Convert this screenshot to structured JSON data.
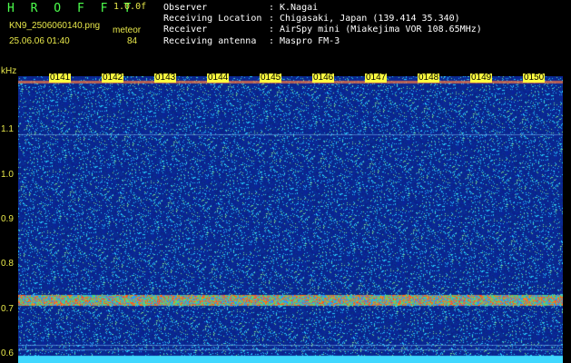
{
  "header": {
    "brand": "H R O F F T",
    "version": "1.0.0f",
    "filename": "KN9_2506060140.png",
    "datetime": "25.06.06 01:40",
    "category_label": "meteor",
    "count": "84",
    "meta": [
      {
        "key": "Observer",
        "value": "K.Nagai"
      },
      {
        "key": "Receiving Location",
        "value": "Chigasaki, Japan (139.414 35.340)"
      },
      {
        "key": "Receiver",
        "value": "AirSpy mini (Miakejima VOR 108.65MHz)"
      },
      {
        "key": "Receiving antenna",
        "value": "Maspro FM-3"
      }
    ]
  },
  "chart_data": {
    "type": "heatmap",
    "ylabel": "kHz",
    "yticks": [
      "1.1",
      "1.0",
      "0.9",
      "0.8",
      "0.7",
      "0.6"
    ],
    "ylim": [
      0.58,
      1.22
    ],
    "xticks": [
      "0141",
      "0142",
      "0143",
      "0144",
      "0145",
      "0146",
      "0147",
      "0148",
      "0149",
      "0150"
    ],
    "carrier_khz": 0.72,
    "colors": {
      "background": "#0a1e8c",
      "noise": "#2aa0ff",
      "carrier": "#ff3030",
      "axis": "#ffff40"
    }
  }
}
